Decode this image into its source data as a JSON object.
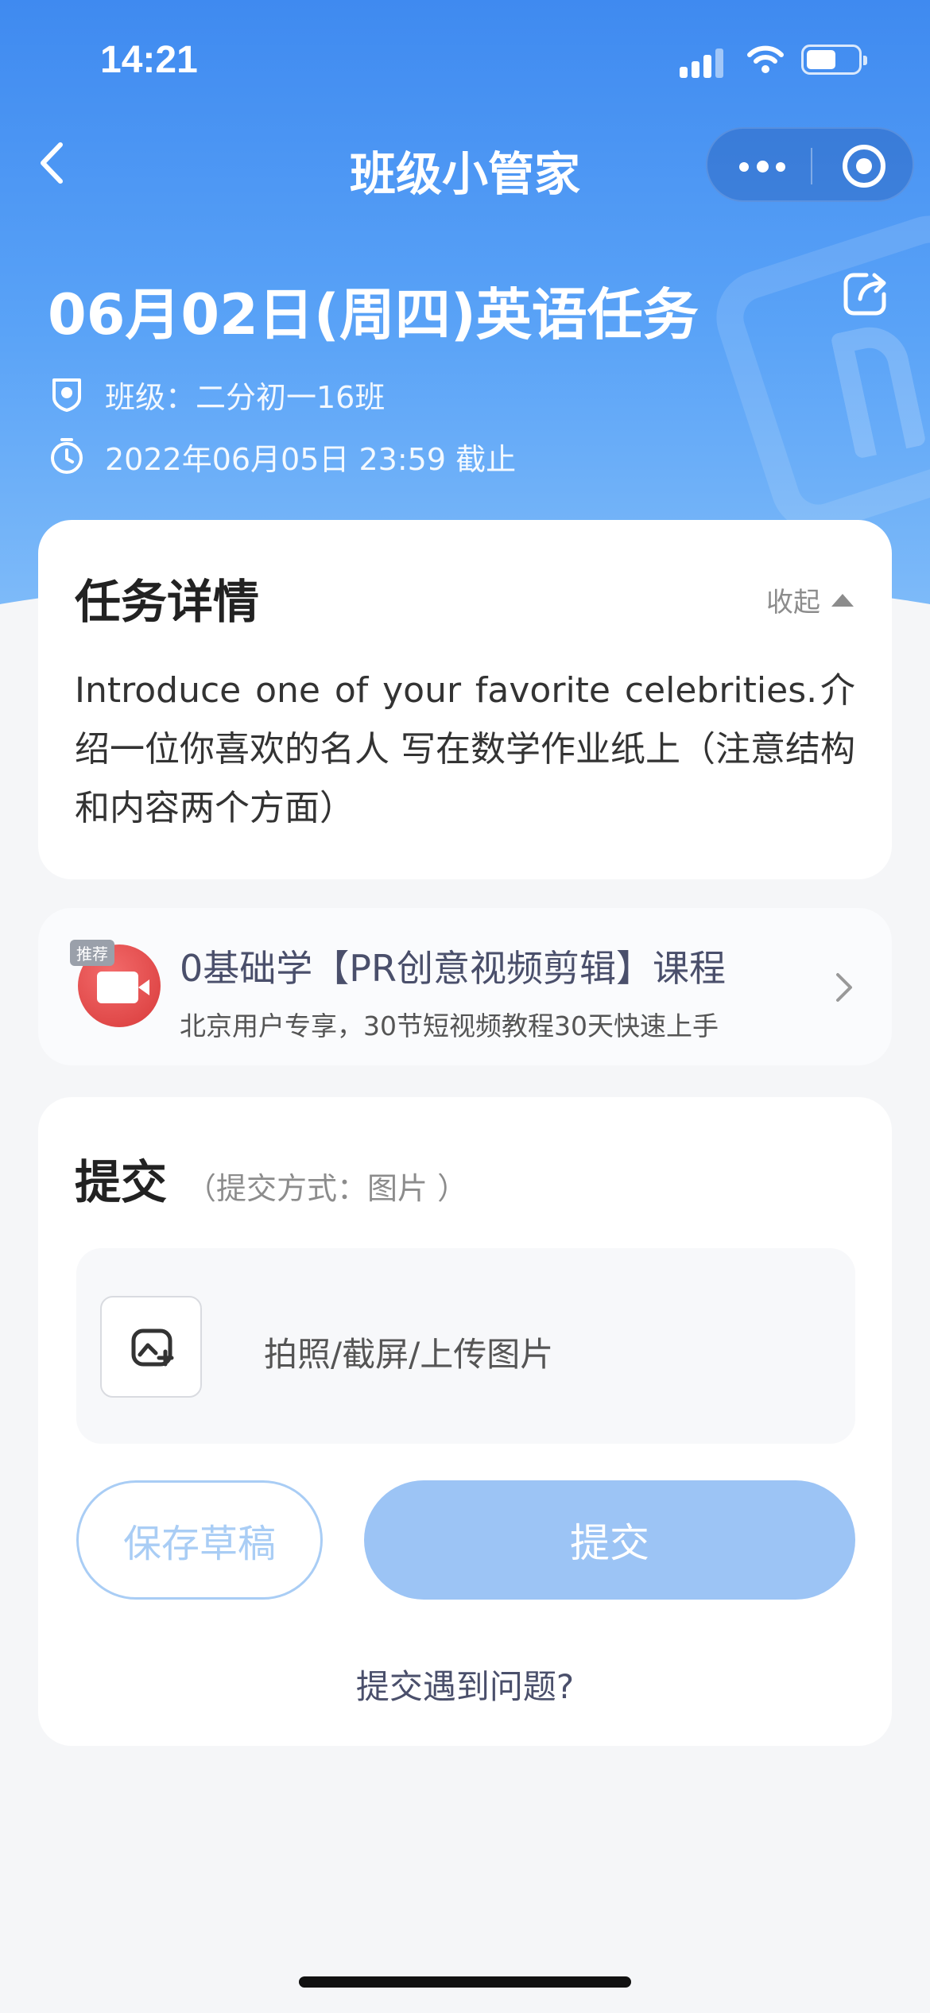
{
  "status_bar": {
    "time": "14:21"
  },
  "nav": {
    "title": "班级小管家"
  },
  "task": {
    "title": "06月02日(周四)英语任务",
    "class_label": "班级：二分初一16班",
    "deadline": "2022年06月05日 23:59 截止"
  },
  "detail": {
    "heading": "任务详情",
    "collapse_label": "收起",
    "body": "Introduce one of your favorite celebrities.介绍一位你喜欢的名人 写在数学作业纸上（注意结构和内容两个方面）"
  },
  "promo": {
    "tag": "推荐",
    "title": "0基础学【PR创意视频剪辑】课程",
    "subtitle": "北京用户专享，30节短视频教程30天快速上手"
  },
  "submit": {
    "heading": "提交",
    "method": "（提交方式：图片 ）",
    "upload_label": "拍照/截屏/上传图片",
    "draft_button": "保存草稿",
    "submit_button": "提交",
    "help_link": "提交遇到问题?"
  },
  "colors": {
    "header_blue": "#3f8af0",
    "submit_disabled": "#9cc4f5",
    "draft_border": "#a9cdf5"
  },
  "icons": [
    "back-arrow-icon",
    "more-dots-icon",
    "target-icon",
    "share-icon",
    "class-badge-icon",
    "clock-icon",
    "video-edit-icon",
    "chevron-right-icon",
    "image-upload-icon"
  ]
}
